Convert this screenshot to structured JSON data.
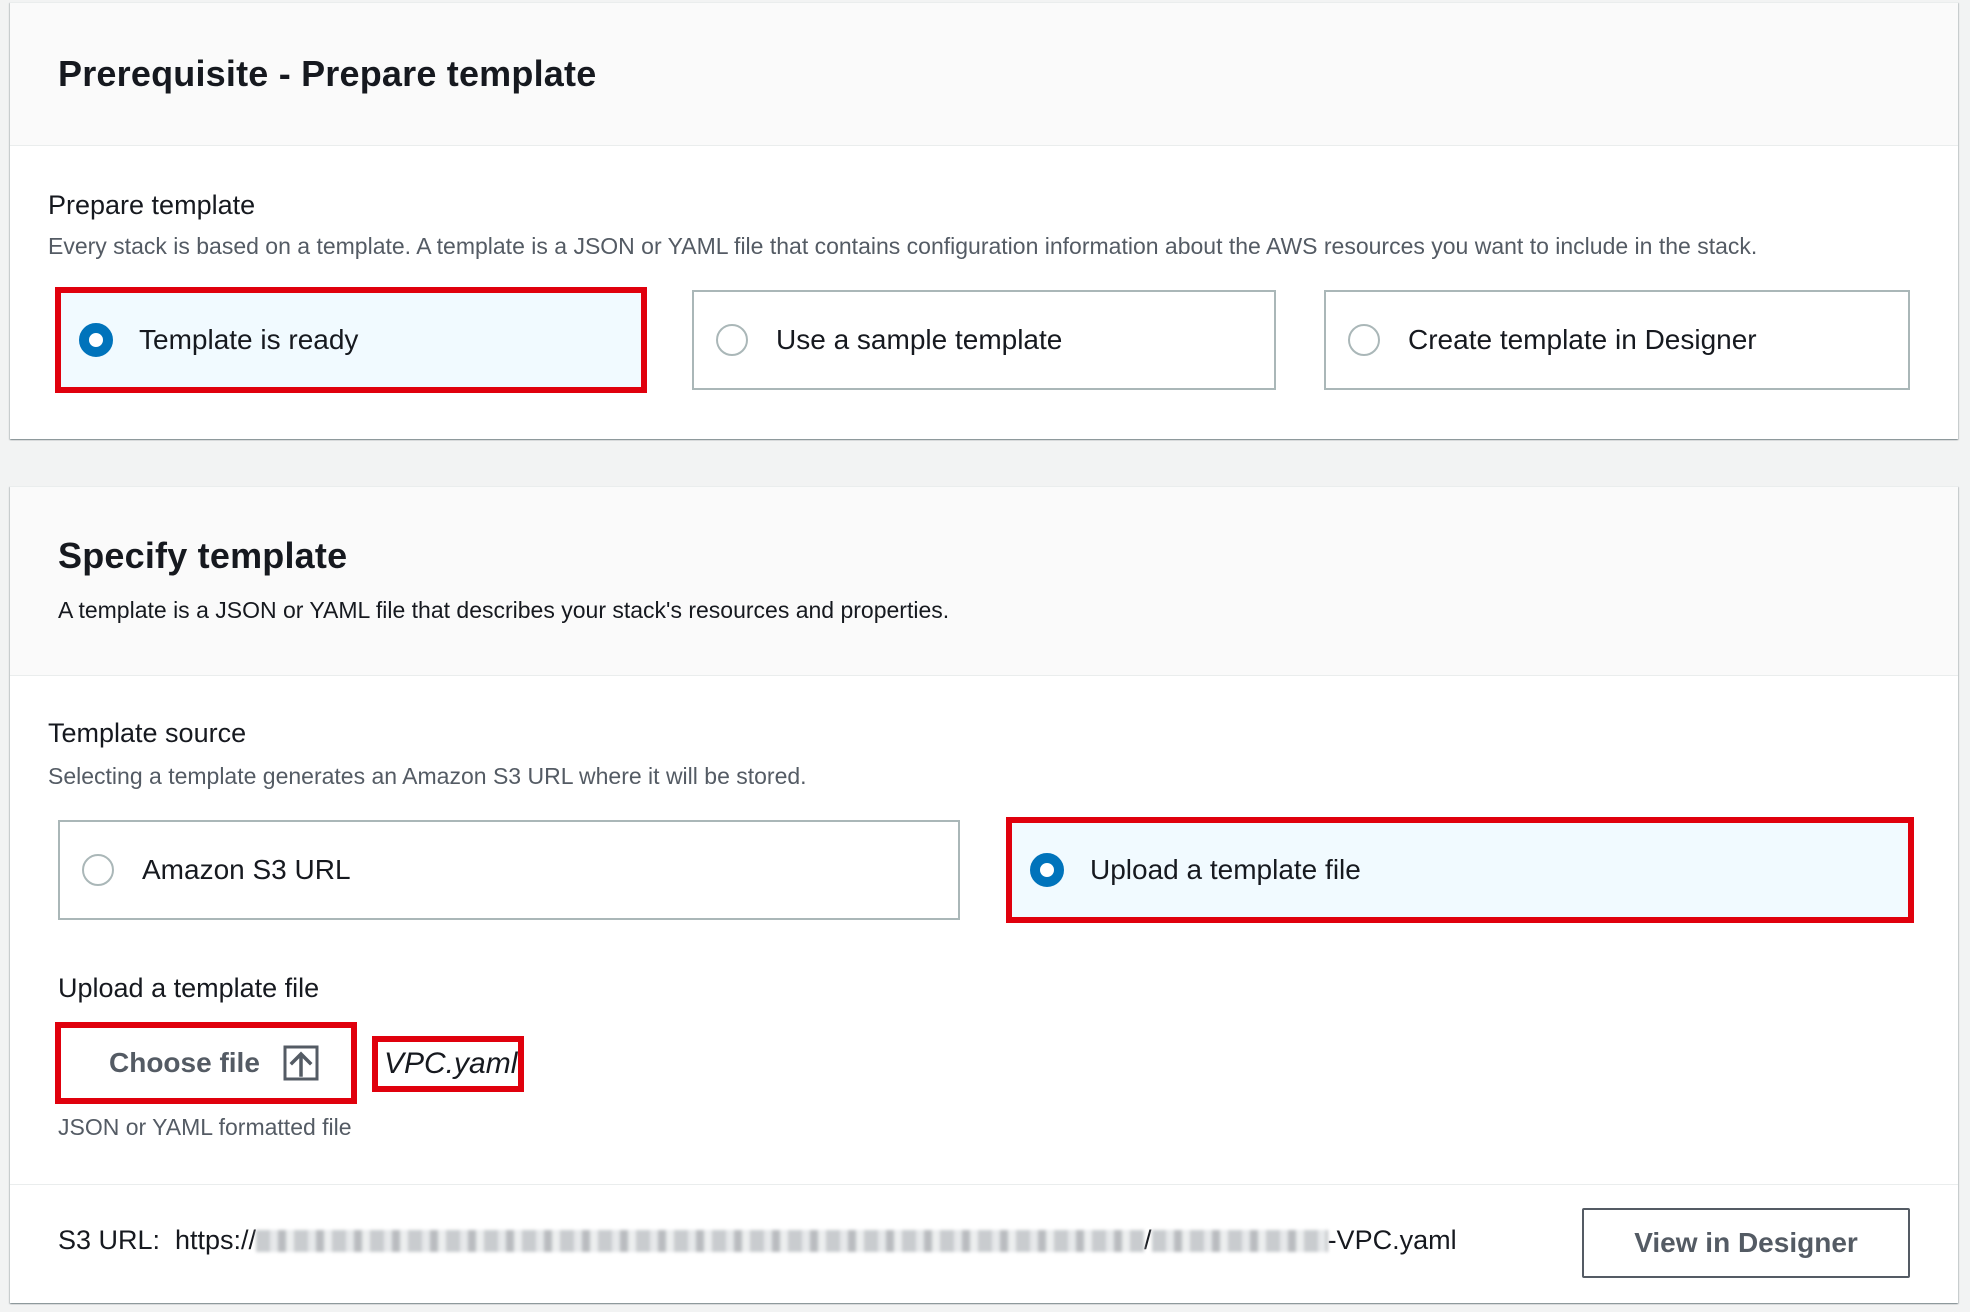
{
  "prerequisite": {
    "title": "Prerequisite - Prepare template",
    "field_label": "Prepare template",
    "field_description": "Every stack is based on a template. A template is a JSON or YAML file that contains configuration information about the AWS resources you want to include in the stack.",
    "options": [
      {
        "label": "Template is ready",
        "selected": true
      },
      {
        "label": "Use a sample template",
        "selected": false
      },
      {
        "label": "Create template in Designer",
        "selected": false
      }
    ]
  },
  "specify": {
    "title": "Specify template",
    "description": "A template is a JSON or YAML file that describes your stack's resources and properties.",
    "source_label": "Template source",
    "source_description": "Selecting a template generates an Amazon S3 URL where it will be stored.",
    "source_options": [
      {
        "label": "Amazon S3 URL",
        "selected": false
      },
      {
        "label": "Upload a template file",
        "selected": true
      }
    ],
    "upload_label": "Upload a template file",
    "choose_file_label": "Choose file",
    "choose_file_icon": "upload-icon",
    "file_name": "VPC.yaml",
    "file_hint": "JSON or YAML formatted file",
    "s3_label": "S3 URL:",
    "s3_url_prefix": "https://",
    "s3_url_separator": "/",
    "s3_url_suffix": "-VPC.yaml",
    "view_designer_label": "View in Designer"
  },
  "colors": {
    "highlight": "#e0000d",
    "radio_selected": "#0073bb",
    "selected_tile_bg": "#f1faff"
  }
}
